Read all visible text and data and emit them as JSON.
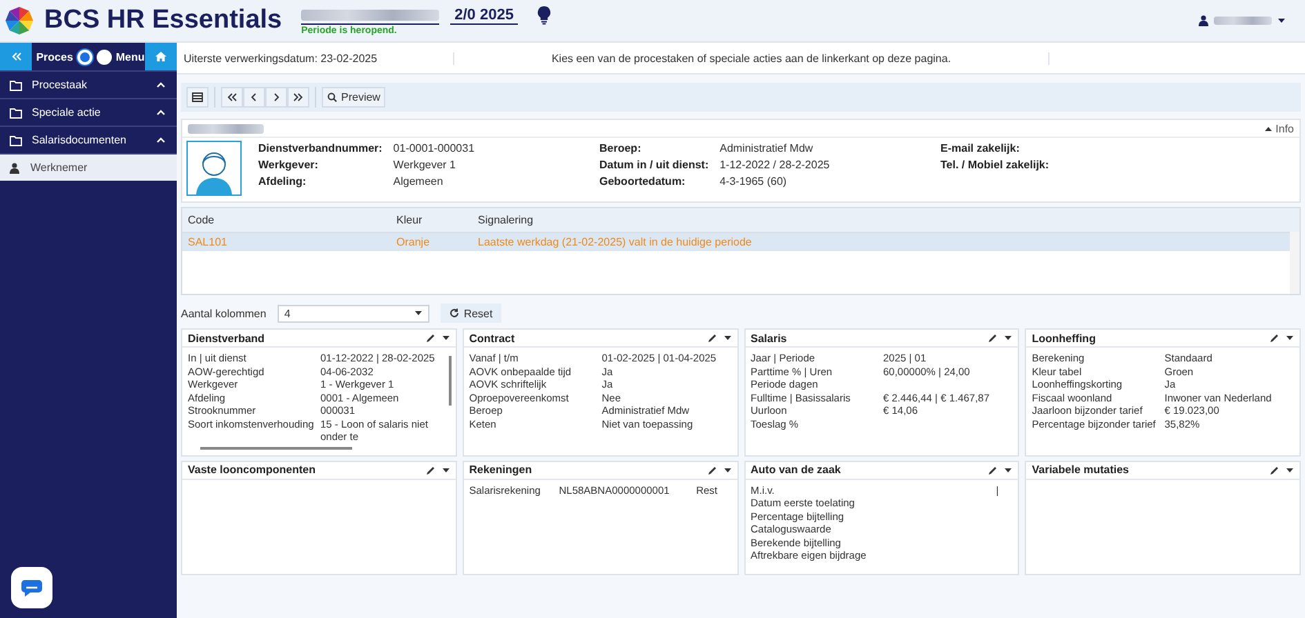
{
  "app": {
    "title": "BCS HR Essentials",
    "period": "2/0 2025",
    "period_status": "Periode is heropend."
  },
  "sidebar": {
    "mode_toggle": [
      {
        "label": "Proces",
        "selected": true
      },
      {
        "label": "Menu",
        "selected": false
      }
    ],
    "sections": [
      {
        "label": "Procestaak",
        "expanded": true
      },
      {
        "label": "Speciale actie",
        "expanded": true
      },
      {
        "label": "Salarisdocumenten",
        "expanded": true
      }
    ],
    "items": [
      {
        "label": "Werknemer",
        "selected": true
      }
    ]
  },
  "message_bar": {
    "deadline": "Uiterste verwerkingsdatum: 23-02-2025",
    "hint": "Kies een van de procestaken of speciale acties aan de linkerkant op deze pagina."
  },
  "toolbar": {
    "preview": "Preview"
  },
  "employee": {
    "info_toggle": "Info",
    "columns": [
      [
        {
          "label": "Dienstverbandnummer:",
          "value": "01-0001-000031"
        },
        {
          "label": "Werkgever:",
          "value": "Werkgever 1"
        },
        {
          "label": "Afdeling:",
          "value": "Algemeen"
        }
      ],
      [
        {
          "label": "Beroep:",
          "value": "Administratief Mdw"
        },
        {
          "label": "Datum in / uit dienst:",
          "value": "1-12-2022 / 28-2-2025"
        },
        {
          "label": "Geboortedatum:",
          "value": "4-3-1965 (60)"
        }
      ],
      [
        {
          "label": "E-mail zakelijk:"
        },
        {
          "label": "Tel. / Mobiel zakelijk:"
        }
      ]
    ]
  },
  "signals": {
    "columns": [
      "Code",
      "Kleur",
      "Signalering"
    ],
    "rows": [
      {
        "cells": [
          "SAL101",
          "Oranje",
          "Laatste werkdag (21-02-2025) valt in de huidige periode"
        ],
        "selected": true
      }
    ]
  },
  "columns_setting": {
    "label": "Aantal kolommen",
    "value": "4",
    "reset": "Reset"
  },
  "panels": [
    {
      "title": "Dienstverband",
      "scrollable": true,
      "rows": [
        {
          "label": "In | uit dienst",
          "value": "01-12-2022 | 28-02-2025"
        },
        {
          "label": "AOW-gerechtigd",
          "value": "04-06-2032"
        },
        {
          "label": "Werkgever",
          "value": "1 - Werkgever 1"
        },
        {
          "label": "Afdeling",
          "value": "0001 - Algemeen"
        },
        {
          "label": "Strooknummer",
          "value": "000031"
        },
        {
          "label": "Soort inkomstenverhouding",
          "value": "15 - Loon of salaris niet onder te"
        }
      ]
    },
    {
      "title": "Contract",
      "scrollable": false,
      "rows": [
        {
          "label": "Vanaf | t/m",
          "value": "01-02-2025 | 01-04-2025"
        },
        {
          "label": "AOVK onbepaalde tijd",
          "value": "Ja"
        },
        {
          "label": "AOVK schriftelijk",
          "value": "Ja"
        },
        {
          "label": "Oproepovereenkomst",
          "value": "Nee"
        },
        {
          "label": "Beroep",
          "value": "Administratief Mdw"
        },
        {
          "label": "Keten",
          "value": "Niet van toepassing"
        }
      ]
    },
    {
      "title": "Salaris",
      "scrollable": false,
      "rows": [
        {
          "label": "Jaar | Periode",
          "value": "2025 | 01"
        },
        {
          "label": "Parttime % | Uren",
          "value": "60,00000% | 24,00"
        },
        {
          "label": "Periode dagen"
        },
        {
          "label": "Fulltime | Basissalaris",
          "value": "€ 2.446,44 | € 1.467,87"
        },
        {
          "label": "Uurloon",
          "value": "€ 14,06"
        },
        {
          "label": "Toeslag %"
        }
      ]
    },
    {
      "title": "Loonheffing",
      "scrollable": false,
      "rows": [
        {
          "label": "Berekening",
          "value": "Standaard"
        },
        {
          "label": "Kleur tabel",
          "value": "Groen"
        },
        {
          "label": "Loonheffingskorting",
          "value": "Ja"
        },
        {
          "label": "Fiscaal woonland",
          "value": "Inwoner van Nederland"
        },
        {
          "label": "Jaarloon bijzonder tarief",
          "value": "€ 19.023,00"
        },
        {
          "label": "Percentage bijzonder tarief",
          "value": "35,82%"
        }
      ]
    },
    {
      "title": "Vaste looncomponenten",
      "scrollable": false
    },
    {
      "title": "Rekeningen",
      "scrollable": false,
      "rows": [
        {
          "label": "Salarisrekening",
          "value": "NL58ABNA0000000001",
          "note": "Rest"
        }
      ]
    },
    {
      "title": "Auto van de zaak",
      "scrollable": false,
      "rows": [
        {
          "label": "M.i.v.",
          "note": "|"
        },
        {
          "label": "Datum eerste toelating"
        },
        {
          "label": "Percentage bijtelling"
        },
        {
          "label": "Cataloguswaarde"
        },
        {
          "label": "Berekende bijtelling"
        },
        {
          "label": "Aftrekbare eigen bijdrage"
        }
      ]
    },
    {
      "title": "Variabele mutaties",
      "scrollable": false
    }
  ]
}
